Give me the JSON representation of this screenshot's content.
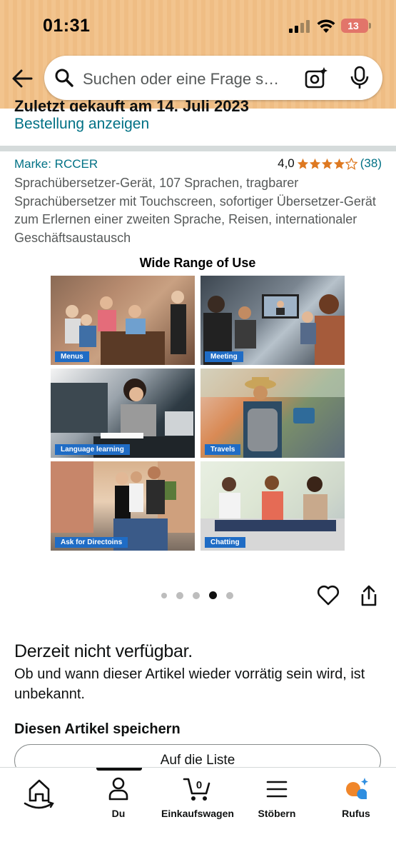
{
  "status_bar": {
    "time": "01:31",
    "battery": "13"
  },
  "search": {
    "placeholder": "Suchen oder eine Frage s…"
  },
  "order": {
    "partial_text": "Zuletzt gekauft am 14. Juli 2023",
    "link": "Bestellung anzeigen"
  },
  "product": {
    "brand": "Marke: RCCER",
    "rating": "4,0",
    "rating_value": 4.0,
    "rating_count": "(38)",
    "title": "Sprachübersetzer-Gerät, 107 Sprachen, tragbarer Sprachübersetzer mit Touchscreen, sofortiger Übersetzer-Gerät zum Erlernen einer zweiten Sprache, Reisen, internationaler Geschäftsaustausch",
    "image": {
      "heading": "Wide Range of Use",
      "tiles": [
        "Menus",
        "Meeting",
        "Language learning",
        "Travels",
        "Ask for Directoins",
        "Chatting"
      ]
    },
    "carousel": {
      "count": 5,
      "active_index": 4
    }
  },
  "availability": {
    "status": "Derzeit nicht verfügbar.",
    "description": "Ob und wann dieser Artikel wieder vorrätig sein wird, ist unbekannt."
  },
  "save": {
    "heading": "Diesen Artikel speichern",
    "button": "Auf die Liste"
  },
  "nav": {
    "home": "",
    "you": "Du",
    "cart": "Einkaufswagen",
    "cart_count": "0",
    "browse": "Stöbern",
    "rufus": "Rufus"
  },
  "colors": {
    "link": "#007185",
    "header": "#f2c48e",
    "star": "#de7921",
    "badge": "#1f6cc5"
  }
}
